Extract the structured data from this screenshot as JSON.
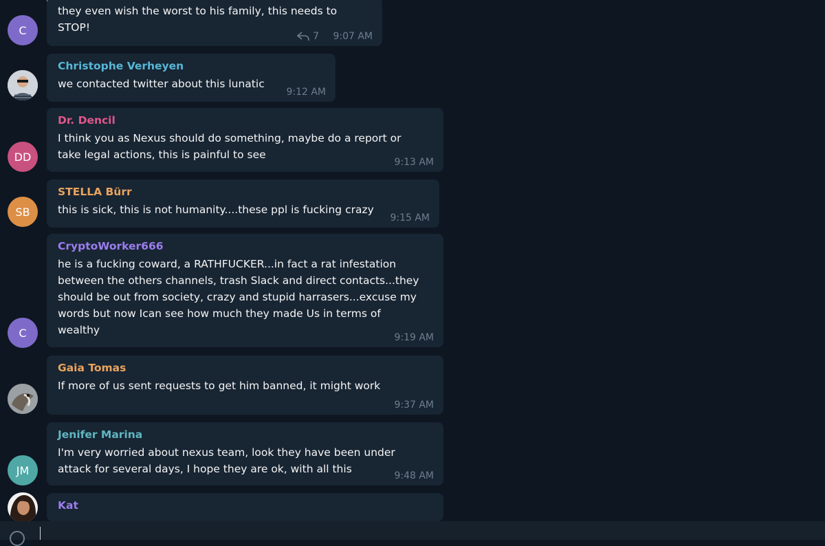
{
  "messages": [
    {
      "author": "",
      "author_color": "#7f7fd5",
      "avatar_initials": "C",
      "avatar_color": "#7e6bc9",
      "lines": [
        "they even wish the worst to his family, this needs to",
        "STOP!"
      ],
      "forward_count": "7",
      "time": "9:07 AM"
    },
    {
      "author": "Christophe Verheyen",
      "author_color": "#58b6d6",
      "avatar_initials": "",
      "avatar_color": "#4a6a8a",
      "lines": [
        "we contacted twitter about this lunatic"
      ],
      "time": "9:12 AM"
    },
    {
      "author": "Dr. Dencil",
      "author_color": "#e0568c",
      "avatar_initials": "DD",
      "avatar_color": "#c9517f",
      "lines": [
        "I think you as Nexus should do something, maybe do a report or",
        "take legal actions, this is painful to see"
      ],
      "time": "9:13 AM"
    },
    {
      "author": "STELLA Bürr",
      "author_color": "#e8a35d",
      "avatar_initials": "SB",
      "avatar_color": "#dd8f46",
      "lines": [
        "this is sick, this is not humanity....these ppl is fucking crazy"
      ],
      "time": "9:15 AM"
    },
    {
      "author": "CryptoWorker666",
      "author_color": "#9b7ded",
      "avatar_initials": "C",
      "avatar_color": "#7e6bc9",
      "lines": [
        "he is a fucking coward, a RATHFUCKER...in fact a rat infestation",
        "between the others channels, trash Slack and direct contacts...they",
        "should be out from society, crazy and stupid harrasers...excuse my",
        "words but now Ican see how much they made Us in terms of",
        "wealthy"
      ],
      "time": "9:19 AM"
    },
    {
      "author": "Gaia Tomas",
      "author_color": "#e8a35d",
      "avatar_initials": "",
      "avatar_color": "#8a8f93",
      "lines": [
        "If more of us sent requests to get him banned, it might work"
      ],
      "time": "9:37 AM"
    },
    {
      "author": "Jenifer Marina",
      "author_color": "#5fb6c2",
      "avatar_initials": "JM",
      "avatar_color": "#4fa8a6",
      "lines": [
        "I'm very worried about nexus team, look they have been under",
        "attack for several days, I hope they are ok, with all this"
      ],
      "time": "9:48 AM"
    },
    {
      "author": "Kat",
      "author_color": "#9b7ded",
      "avatar_initials": "",
      "avatar_color": "#3a2a22",
      "lines": [
        ""
      ],
      "time": ""
    }
  ],
  "composer": {
    "placeholder": ""
  },
  "icons": {
    "forward": "reply-arrow-icon",
    "attach": "paperclip-icon"
  }
}
